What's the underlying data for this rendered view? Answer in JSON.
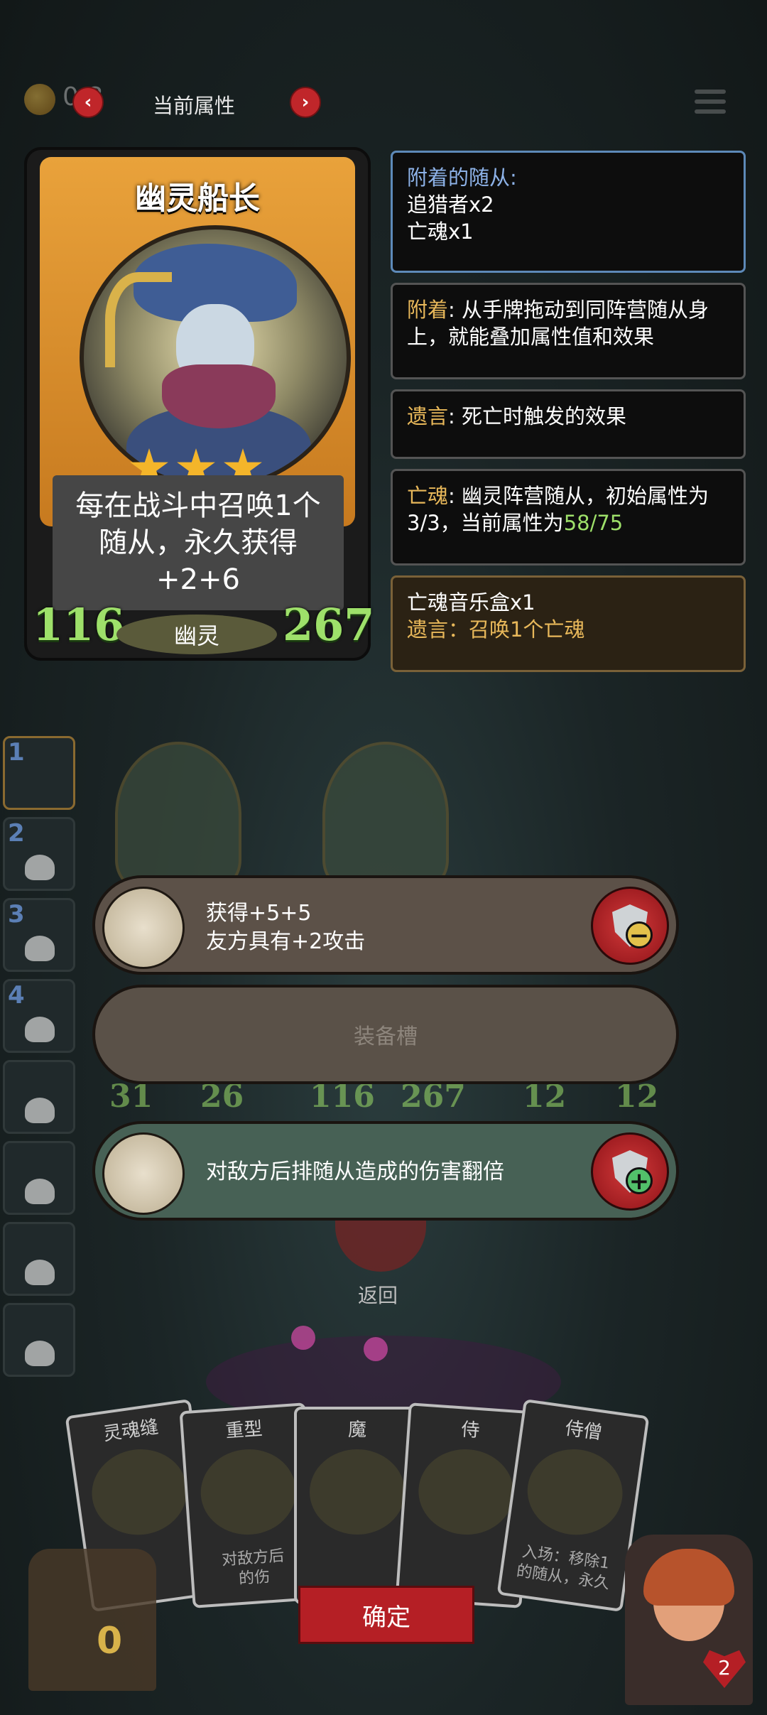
{
  "topbar": {
    "coin_value": "0 8",
    "prev_arrow": "‹",
    "next_arrow": "›",
    "title": "当前属性"
  },
  "card": {
    "name": "幽灵船长",
    "stars": 3,
    "description_line1": "每在战斗中召唤1个",
    "description_line2": "随从，永久获得+2+6",
    "attack": "116",
    "health": "267",
    "tribe": "幽灵"
  },
  "info": {
    "attached_title": "附着的随从:",
    "attached_1": "追猎者x2",
    "attached_2": "亡魂x1",
    "attach_kw": "附着",
    "attach_desc": ": 从手牌拖动到同阵营随从身上，就能叠加属性值和效果",
    "deathrattle_kw": "遗言",
    "deathrattle_desc": ": 死亡时触发的效果",
    "soul_kw": "亡魂",
    "soul_desc": ": 幽灵阵营随从，初始属性为3/3，当前属性为",
    "soul_stats": "58/75",
    "item_name": "亡魂音乐盒x1",
    "item_desc": "遗言：召唤1个亡魂"
  },
  "equipment": {
    "slot1_line1": "获得+5+5",
    "slot1_line2": "友方具有+2攻击",
    "slot2_label": "装备槽",
    "slot3_text": "对敌方后排随从造成的伤害翻倍"
  },
  "board": {
    "slot_numbers": [
      "1",
      "2",
      "3",
      "4"
    ],
    "stats": [
      "31",
      "26",
      "116",
      "267",
      "12",
      "12"
    ],
    "back_label": "返回"
  },
  "hand": {
    "cards": [
      {
        "title": "灵魂缝",
        "text": ""
      },
      {
        "title": "重型",
        "text": "对敌方后\n的伤"
      },
      {
        "title": "魔",
        "text": ""
      },
      {
        "title": "侍",
        "text": ""
      },
      {
        "title": "侍僧",
        "text": "入场：移除1\n的随从，永久"
      }
    ],
    "confirm_label": "确定",
    "chest_value": "0",
    "hero_hp": "2"
  },
  "colors": {
    "accent_red": "#b51f25",
    "stat_green": "#9ee06a",
    "keyword_gold": "#e8b85a",
    "keyword_blue": "#8db2e8"
  }
}
